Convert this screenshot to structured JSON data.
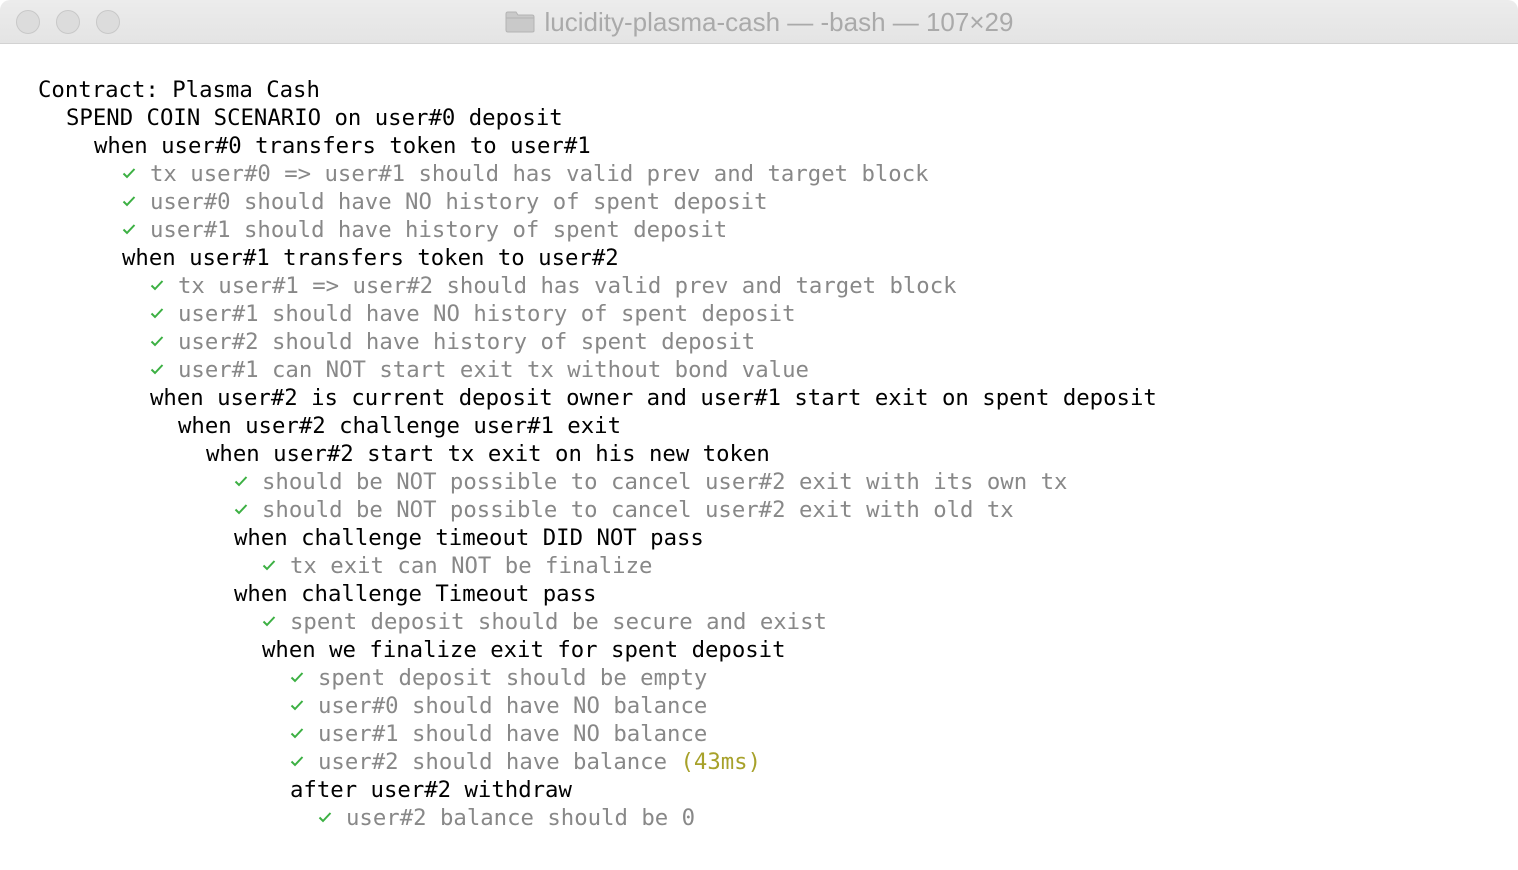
{
  "window": {
    "title": "lucidity-plasma-cash — -bash — 107×29",
    "folder_icon": "folder-icon"
  },
  "colors": {
    "check": "#3cb043",
    "pass_text": "#888888",
    "timing": "#a7a12a"
  },
  "lines": [
    {
      "indent": 0,
      "type": "heading",
      "text": "Contract: Plasma Cash"
    },
    {
      "indent": 1,
      "type": "heading",
      "text": "SPEND COIN SCENARIO on user#0 deposit"
    },
    {
      "indent": 2,
      "type": "heading",
      "text": "when user#0 transfers token to user#1"
    },
    {
      "indent": 3,
      "type": "pass",
      "text": "tx user#0 => user#1 should has valid prev and target block"
    },
    {
      "indent": 3,
      "type": "pass",
      "text": "user#0 should have NO history of spent deposit"
    },
    {
      "indent": 3,
      "type": "pass",
      "text": "user#1 should have history of spent deposit"
    },
    {
      "indent": 3,
      "type": "heading",
      "text": "when user#1 transfers token to user#2"
    },
    {
      "indent": 4,
      "type": "pass",
      "text": "tx user#1 => user#2 should has valid prev and target block"
    },
    {
      "indent": 4,
      "type": "pass",
      "text": "user#1 should have NO history of spent deposit"
    },
    {
      "indent": 4,
      "type": "pass",
      "text": "user#2 should have history of spent deposit"
    },
    {
      "indent": 4,
      "type": "pass",
      "text": "user#1 can NOT start exit tx without bond value"
    },
    {
      "indent": 4,
      "type": "heading",
      "text": "when user#2 is current deposit owner and user#1 start exit on spent deposit"
    },
    {
      "indent": 5,
      "type": "heading",
      "text": "when user#2 challenge user#1 exit"
    },
    {
      "indent": 6,
      "type": "heading",
      "text": "when user#2 start tx exit on his new token"
    },
    {
      "indent": 7,
      "type": "pass",
      "text": "should be NOT possible to cancel user#2 exit with its own tx"
    },
    {
      "indent": 7,
      "type": "pass",
      "text": "should be NOT possible to cancel user#2 exit with old tx"
    },
    {
      "indent": 7,
      "type": "heading",
      "text": "when challenge timeout DID NOT pass"
    },
    {
      "indent": 8,
      "type": "pass",
      "text": "tx exit can NOT be finalize"
    },
    {
      "indent": 7,
      "type": "heading",
      "text": "when challenge Timeout pass"
    },
    {
      "indent": 8,
      "type": "pass",
      "text": "spent deposit should be secure and exist"
    },
    {
      "indent": 8,
      "type": "heading",
      "text": "when we finalize exit for spent deposit"
    },
    {
      "indent": 9,
      "type": "pass",
      "text": "spent deposit should be empty"
    },
    {
      "indent": 9,
      "type": "pass",
      "text": "user#0 should have NO balance"
    },
    {
      "indent": 9,
      "type": "pass",
      "text": "user#1 should have NO balance"
    },
    {
      "indent": 9,
      "type": "pass",
      "text": "user#2 should have balance",
      "timing": "(43ms)"
    },
    {
      "indent": 9,
      "type": "heading",
      "text": "after user#2 withdraw"
    },
    {
      "indent": 10,
      "type": "pass",
      "text": "user#2 balance should be 0"
    }
  ]
}
